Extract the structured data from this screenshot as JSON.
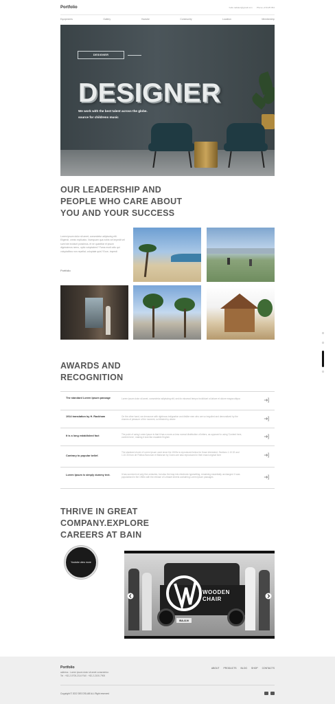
{
  "header": {
    "logo": "Portfolio",
    "email": "hello.radiator@gmail.com",
    "phone": "Phone:+9 9125 954"
  },
  "nav": {
    "items": [
      "Equipments",
      "Gallery",
      "Youtube",
      "Community",
      "Location",
      "Membership"
    ]
  },
  "hero": {
    "badge": "DESIGNER",
    "title": "DESIGNER",
    "subtitle_line1": "We work with the best talent across the globe.",
    "subtitle_line2": "source for childrens music"
  },
  "leadership": {
    "heading_line1": "OUR LEADERSHIP AND",
    "heading_line2": "PEOPLE WHO CARE ABOUT",
    "heading_line3": "YOU AND YOUR SUCCESS",
    "text": "Lorem ipsum dolor sit amet, consectetur adipiscing elit. Eligendi, omnis explicabo. Numquam qua nobis vel impedit vel sunt iste incidunt possimus, et ne quantitar et ipsum dignissimos nemo, optio voluptatem? Fuma modi odio qui voluptatibus non repellat, voluptate quis? Ecce, imperdi",
    "link": "Portfolio"
  },
  "awards": {
    "heading_line1": "AWARDS AND",
    "heading_line2": "RECOGNITION",
    "rows": [
      {
        "title": "The standard Lorem Ipsum passage",
        "desc": "Lorem ipsum dolor sit amet, consectetur adipiscing elit, sed do eiusmod tempor incididunt ut labore et dolore magna aliqua"
      },
      {
        "title": "1914 translation by H. Rackham",
        "desc": "On the other hand, we denounce with righteous indignation and dislike men who are so beguiled and demoralized by the charms of pleasure of the moment, so blinded by desire"
      },
      {
        "title": "It is a long established fact",
        "desc": "The point of using Lorem Ipsum is that it has a more-or-less normal distribution of letters, as opposed to using 'Content here, content here', making it look like readable English"
      },
      {
        "title": "Contrary to popular belief.",
        "desc": "The standard chunk of Lorem Ipsum used since the 1500s is reproduced below for those interested. Sections 1.10.32 and 1.10.33 from de Finibus Bonorum et Malorum by Cicero are also reproduced in their exact original form"
      },
      {
        "title": "Lorem Ipsum is simply dummy text.",
        "desc": "It has survived not only five centuries, but also the leap into electronic typesetting, remaining essentially unchanged. It was popularised in the 1960s with the release of Letraset sheets containing Lorem Ipsum passages"
      }
    ]
  },
  "careers": {
    "heading_line1": "THRIVE IN GREAT",
    "heading_line2": "COMPANY.EXPLORE",
    "heading_line3": "CAREERS AT BAIN",
    "circle_button": "Youtube view more",
    "video_brand_line1": "WOODEN",
    "video_brand_line2": "CHAIR",
    "plate": "BA-8-N"
  },
  "footer": {
    "logo": "Portfolio",
    "address": "address : Lorem ipsum dolor sit amet consectetur.",
    "phones": "Tel : +82-2-0700-2114 FAX : +82-2-2100-7900",
    "nav": [
      "ABOUT",
      "PRODUCTS",
      "BLOG",
      "SHOP",
      "CONTACTS"
    ],
    "copyright": "Copyright © 2022 DECOSLAB ALL Right reserved"
  },
  "colors": {
    "hero_bg": "#3f484c",
    "chair": "#1f3a42",
    "accent_dark": "#111111",
    "footer_bg": "#efefef"
  }
}
